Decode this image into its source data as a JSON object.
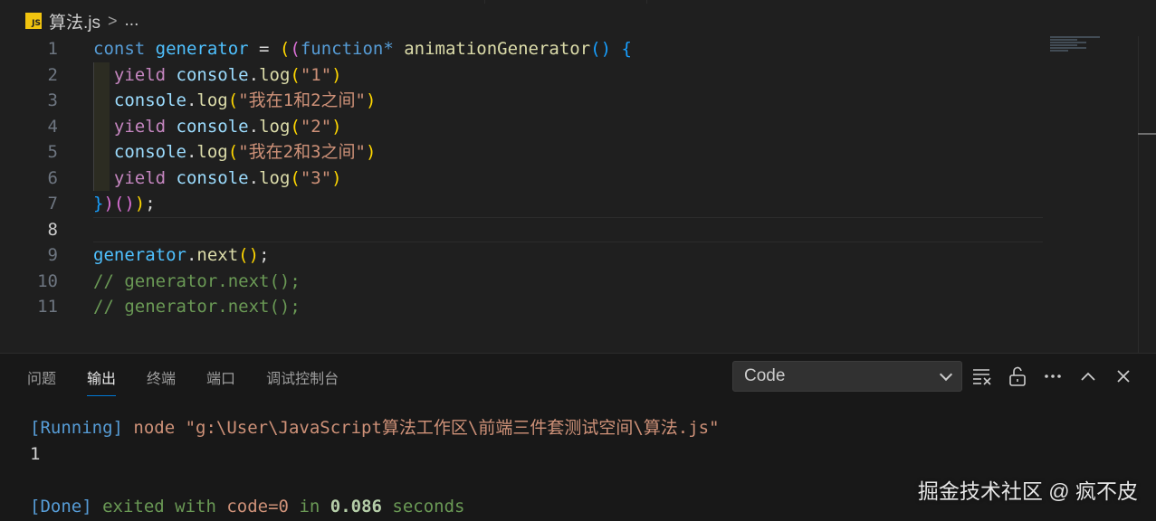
{
  "breadcrumb": {
    "file_icon": "JS",
    "file": "算法.js",
    "separator": ">",
    "more": "..."
  },
  "code_lines": [
    {
      "n": "1",
      "tokens": [
        [
          "kw",
          "const "
        ],
        [
          "var",
          "generator"
        ],
        [
          "op",
          " = "
        ],
        [
          "b1",
          "("
        ],
        [
          "b2",
          "("
        ],
        [
          "kw",
          "function"
        ],
        [
          "kw",
          "* "
        ],
        [
          "fn",
          "animationGenerator"
        ],
        [
          "b3",
          "()"
        ],
        [
          "op",
          " "
        ],
        [
          "b3",
          "{"
        ]
      ]
    },
    {
      "n": "2",
      "tokens": [
        [
          "op",
          "  "
        ],
        [
          "ctl",
          "yield "
        ],
        [
          "obj",
          "console"
        ],
        [
          "op",
          "."
        ],
        [
          "fn",
          "log"
        ],
        [
          "b1",
          "("
        ],
        [
          "str",
          "\"1\""
        ],
        [
          "b1",
          ")"
        ]
      ]
    },
    {
      "n": "3",
      "tokens": [
        [
          "op",
          "  "
        ],
        [
          "obj",
          "console"
        ],
        [
          "op",
          "."
        ],
        [
          "fn",
          "log"
        ],
        [
          "b1",
          "("
        ],
        [
          "str",
          "\"我在1和2之间\""
        ],
        [
          "b1",
          ")"
        ]
      ]
    },
    {
      "n": "4",
      "tokens": [
        [
          "op",
          "  "
        ],
        [
          "ctl",
          "yield "
        ],
        [
          "obj",
          "console"
        ],
        [
          "op",
          "."
        ],
        [
          "fn",
          "log"
        ],
        [
          "b1",
          "("
        ],
        [
          "str",
          "\"2\""
        ],
        [
          "b1",
          ")"
        ]
      ]
    },
    {
      "n": "5",
      "tokens": [
        [
          "op",
          "  "
        ],
        [
          "obj",
          "console"
        ],
        [
          "op",
          "."
        ],
        [
          "fn",
          "log"
        ],
        [
          "b1",
          "("
        ],
        [
          "str",
          "\"我在2和3之间\""
        ],
        [
          "b1",
          ")"
        ]
      ]
    },
    {
      "n": "6",
      "tokens": [
        [
          "op",
          "  "
        ],
        [
          "ctl",
          "yield "
        ],
        [
          "obj",
          "console"
        ],
        [
          "op",
          "."
        ],
        [
          "fn",
          "log"
        ],
        [
          "b1",
          "("
        ],
        [
          "str",
          "\"3\""
        ],
        [
          "b1",
          ")"
        ]
      ]
    },
    {
      "n": "7",
      "tokens": [
        [
          "b3",
          "}"
        ],
        [
          "b2",
          ")"
        ],
        [
          "b2",
          "()"
        ],
        [
          "b1",
          ")"
        ],
        [
          "op",
          ";"
        ]
      ]
    },
    {
      "n": "8",
      "tokens": []
    },
    {
      "n": "9",
      "tokens": [
        [
          "var",
          "generator"
        ],
        [
          "op",
          "."
        ],
        [
          "fn",
          "next"
        ],
        [
          "b1",
          "()"
        ],
        [
          "op",
          ";"
        ]
      ]
    },
    {
      "n": "10",
      "tokens": [
        [
          "cm",
          "// generator.next();"
        ]
      ]
    },
    {
      "n": "11",
      "tokens": [
        [
          "cm",
          "// generator.next();"
        ]
      ]
    }
  ],
  "active_line": "8",
  "panel": {
    "tabs": [
      {
        "label": "问题",
        "active": false
      },
      {
        "label": "输出",
        "active": true
      },
      {
        "label": "终端",
        "active": false
      },
      {
        "label": "端口",
        "active": false
      },
      {
        "label": "调试控制台",
        "active": false
      }
    ],
    "output_channel": "Code",
    "icons": [
      "clear-output-icon",
      "lock-icon",
      "more-icon",
      "maximize-panel-icon",
      "close-panel-icon"
    ]
  },
  "output": {
    "running_tag": "[Running]",
    "running_cmd": " node \"g:\\User\\JavaScript算法工作区\\前端三件套测试空间\\算法.js\"",
    "result": "1",
    "done_tag": "[Done]",
    "done_text1": " exited with ",
    "done_code": "code=0",
    "done_text2": " in ",
    "done_time": "0.086",
    "done_text3": " seconds"
  },
  "watermark": "掘金技术社区 @ 疯不皮",
  "colors": {
    "editor_bg": "#1f1f1f",
    "panel_bg": "#181818",
    "accent": "#0078d4",
    "js_icon": "#f1c40f"
  }
}
